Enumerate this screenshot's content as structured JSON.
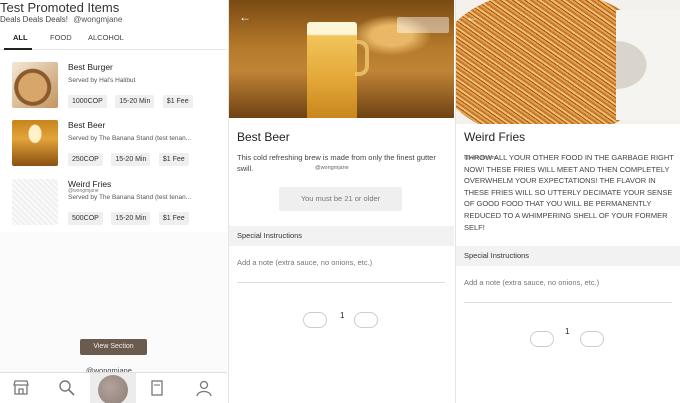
{
  "p1": {
    "title": "Test Promoted Items",
    "subtitle": "Deals Deals Deals!",
    "handle": "@wongmjane",
    "tabs": [
      "ALL",
      "FOOD",
      "ALCOHOL"
    ],
    "items": [
      {
        "name": "Best Burger",
        "served": "Served by Hal's Halibut",
        "price": "1000COP",
        "time": "15-20 Min",
        "fee": "$1 Fee",
        "handle": ""
      },
      {
        "name": "Best Beer",
        "served": "Served by The Banana Stand (test tenan...",
        "price": "250COP",
        "time": "15-20 Min",
        "fee": "$1 Fee",
        "handle": ""
      },
      {
        "name": "Weird Fries",
        "served": "Served by The Banana Stand (test tenan...",
        "price": "500COP",
        "time": "15-20 Min",
        "fee": "$1 Fee",
        "handle": "@wongmjane"
      }
    ],
    "view_section": "View Section",
    "overlay_handle": "@wongmjane",
    "nav": [
      "store-icon",
      "search-icon",
      "avatar",
      "orders-icon",
      "profile-icon"
    ]
  },
  "p2": {
    "title": "Best Beer",
    "description": "This cold refreshing brew is made from only the finest gutter swill.",
    "handle": "@wongmjane",
    "age_button": "You must be 21 or older",
    "special_instructions": "Special Instructions",
    "note_placeholder": "Add a note (extra sauce, no onions, etc.)",
    "quantity": "1"
  },
  "p3": {
    "title": "Weird Fries",
    "description": "THROW ALL YOUR OTHER FOOD IN THE GARBAGE RIGHT NOW! THESE FRIES WILL MEET AND THEN COMPLETELY OVERWHELM YOUR EXPECTATIONS! THE FLAVOR IN THESE FRIES WILL SO UTTERLY DECIMATE YOUR SENSE OF GOOD FOOD THAT YOU WILL BE PERMANENTLY REDUCED TO A WHIMPERING SHELL OF YOUR FORMER SELF!",
    "handle": "@wongmjane",
    "special_instructions": "Special Instructions",
    "note_placeholder": "Add a note (extra sauce, no onions, etc.)",
    "quantity": "1"
  }
}
